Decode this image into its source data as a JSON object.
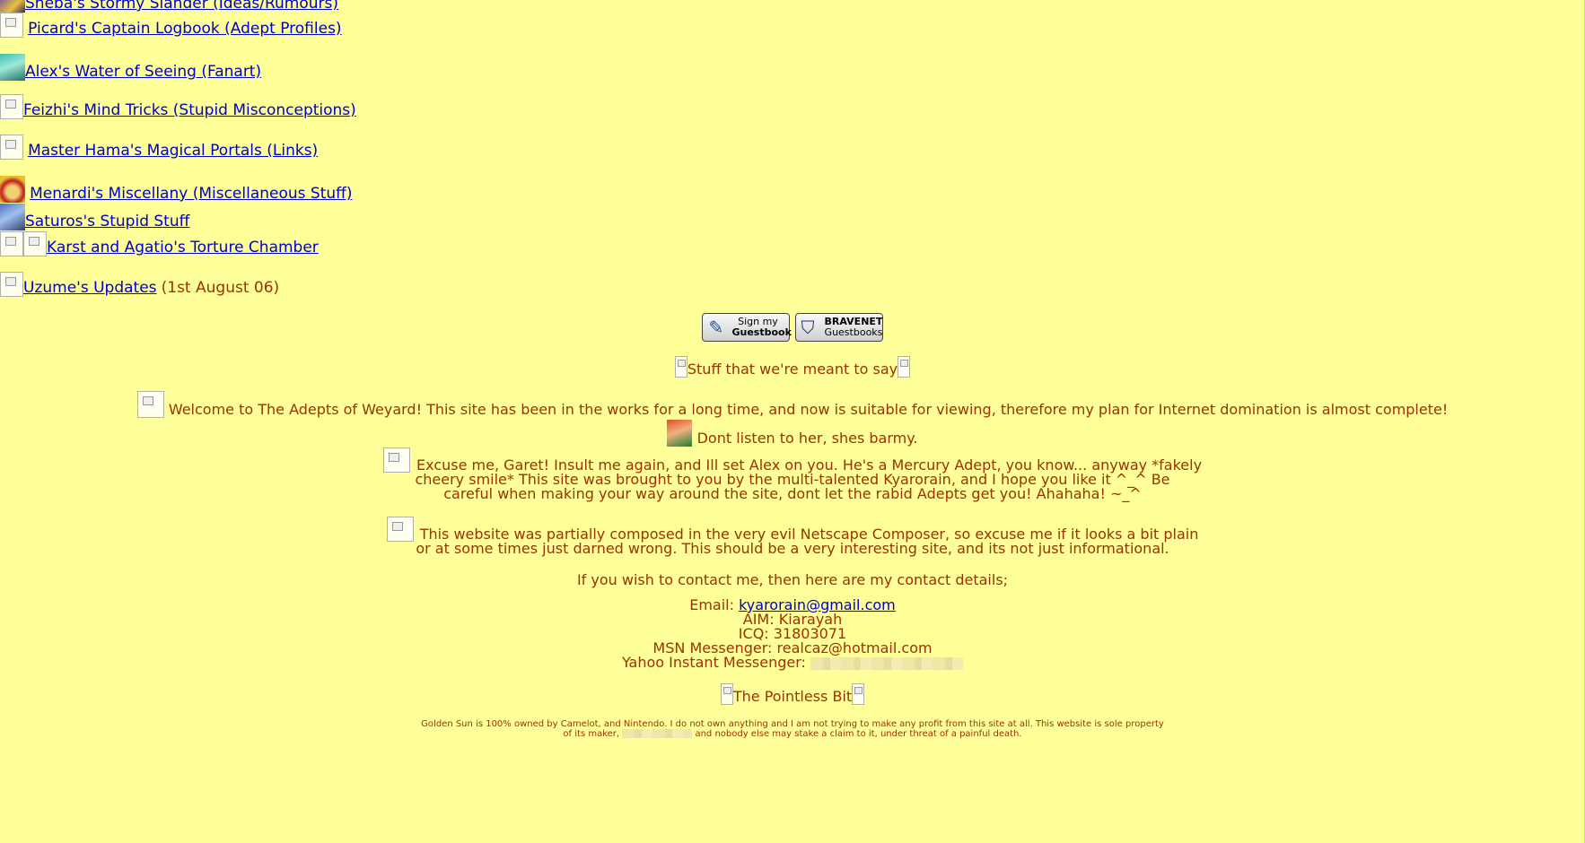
{
  "nav": {
    "items": [
      {
        "label": "Sheba's Stormy Slander (Ideas/Rumours)",
        "icon": "sheba-avatar"
      },
      {
        "label": "Picard's Captain Logbook (Adept Profiles)",
        "icon": "broken-image-icon"
      },
      {
        "label": "Alex's Water of Seeing (Fanart)",
        "icon": "alex-avatar"
      },
      {
        "label": "Feizhi's Mind Tricks (Stupid Misconceptions)",
        "icon": "broken-image-icon"
      },
      {
        "label": "Master Hama's Magical Portals (Links)",
        "icon": "broken-image-icon"
      },
      {
        "label": "Menardi's Miscellany (Miscellaneous Stuff)",
        "icon": "menardi-avatar"
      },
      {
        "label": "Saturos's Stupid Stuff",
        "icon": "saturos-avatar"
      },
      {
        "label": "Karst and Agatio's Torture Chamber",
        "icon": "broken-image-icon"
      },
      {
        "label": "Uzume's Updates",
        "icon": "broken-image-icon",
        "note": "(1st August 06)"
      }
    ]
  },
  "guestbook": {
    "sign_line1": "Sign my",
    "sign_line2": "Guestbook",
    "brand_line1": "BRAVENET",
    "brand_line2": "Guestbooks"
  },
  "section1_title": "Stuff that we're meant to say",
  "welcome": "Welcome to The Adepts of Weyard! This site has been in the works for a long time, and now is suitable for viewing, therefore my plan for Internet domination is almost complete!",
  "garet": "Dont listen to her, shes barmy.",
  "excuse": {
    "line1": "Excuse me, Garet! Insult me again, and Ill set Alex on you. He's a Mercury Adept, you know... anyway *fakely",
    "line2": "cheery smile* This site was brought to you by the multi-talented Kyarorain, and I hope you like it ^_^ Be",
    "line3": "careful when making your way around the site, dont let the rabid Adepts get you! Ahahaha! ~_^"
  },
  "netscape": {
    "line1": "This website was partially composed in the very evil Netscape Composer, so excuse me if it looks a bit plain",
    "line2": "or at some times just darned wrong. This should be a very interesting site, and its not just informational."
  },
  "contact_intro": "If you wish to contact me, then here are my contact details;",
  "contact": {
    "email_label": "Email:",
    "email": "kyarorain@gmail.com",
    "aim": "AIM: Kiarayah",
    "icq": "ICQ: 31803071",
    "msn": "MSN Messenger: realcaz@hotmail.com",
    "yahoo_label": "Yahoo Instant Messenger:"
  },
  "section2_title": "The Pointless Bit",
  "footer": {
    "line1": "Golden Sun is 100% owned by Camelot, and Nintendo. I do not own anything and I am not trying to make any profit from this site at all. This website is sole property",
    "line2a": "of its maker,",
    "line2b": "and nobody else may stake a claim to it, under threat of a painful death."
  },
  "colors": {
    "background": "#ffff99",
    "text": "#993300",
    "link": "#0000cc"
  }
}
